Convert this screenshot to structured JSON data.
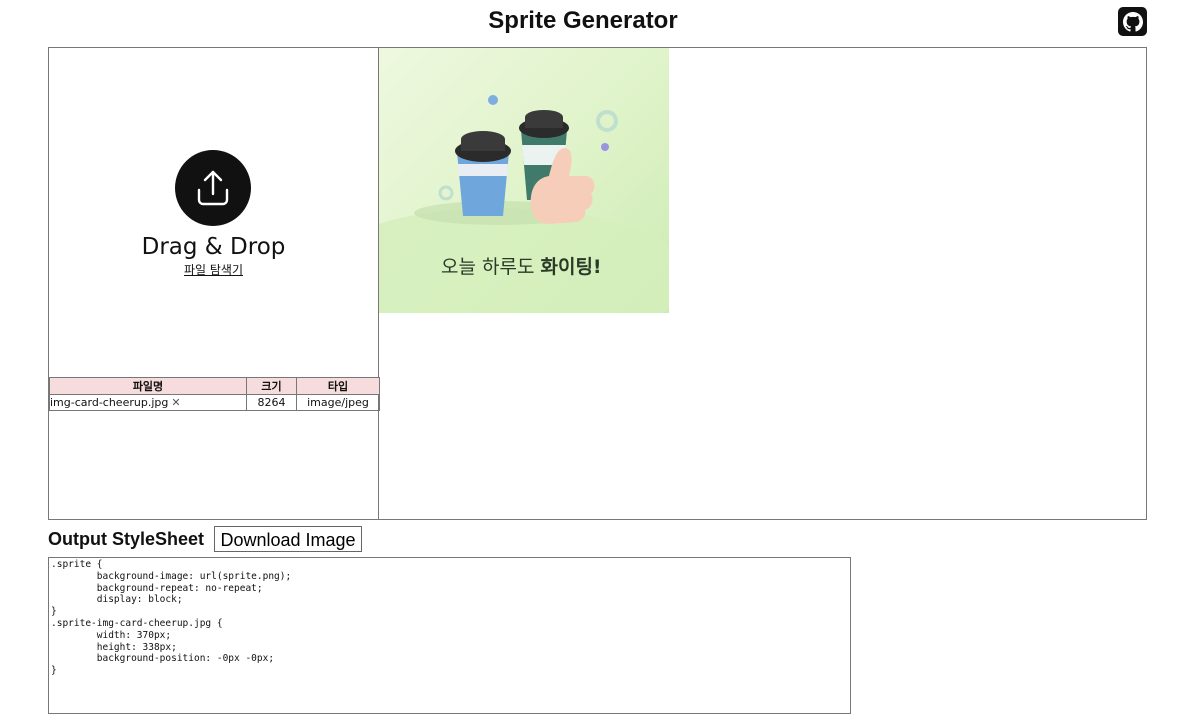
{
  "app": {
    "title": "Sprite Generator"
  },
  "header": {
    "github_icon": "github-icon"
  },
  "drop_zone": {
    "icon": "upload-icon",
    "title": "Drag & Drop",
    "browse_link": "파일 탐색기"
  },
  "file_table": {
    "columns": [
      "파일명",
      "크기",
      "타입"
    ],
    "rows": [
      {
        "name": "img-card-cheerup.jpg",
        "size": "8264",
        "type": "image/jpeg",
        "remove_icon": "close-icon"
      }
    ]
  },
  "preview": {
    "caption_normal": "오늘 하루도 ",
    "caption_bold": "화이팅!",
    "accent_colors": {
      "bg": "#dff3c9",
      "cup_blue": "#6fa6dc",
      "cup_green": "#3f7a6a"
    }
  },
  "output": {
    "label": "Output StyleSheet",
    "download_label": "Download Image",
    "stylesheet": ".sprite {\n        background-image: url(sprite.png);\n        background-repeat: no-repeat;\n        display: block;\n}\n.sprite-img-card-cheerup.jpg {\n        width: 370px;\n        height: 338px;\n        background-position: -0px -0px;\n}"
  }
}
